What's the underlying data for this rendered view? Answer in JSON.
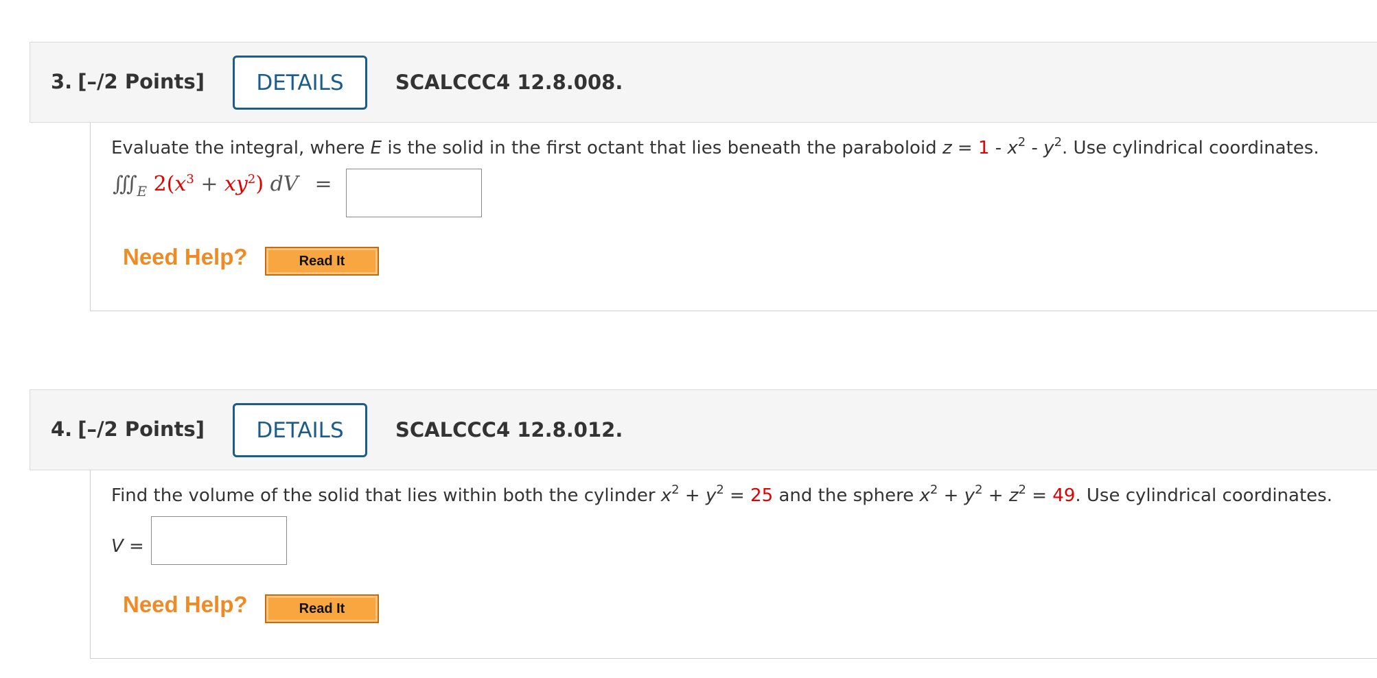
{
  "questions": [
    {
      "number": "3.",
      "points": "[–/2 Points]",
      "details_label": "DETAILS",
      "code": "SCALCCC4 12.8.008.",
      "prompt": {
        "p1": "Evaluate the integral, where ",
        "var_e": "E",
        "p2": " is the solid in the first octant that lies beneath the paraboloid ",
        "var_z": "z",
        "p3": " = ",
        "value": "1",
        "p4": " - ",
        "var_x": "x",
        "exp1": "2",
        "p5": " - ",
        "var_y": "y",
        "exp2": "2",
        "p6": ". Use cylindrical coordinates."
      },
      "integral": {
        "symbol": "∭",
        "region": "E",
        "coef": "2(",
        "x": "x",
        "x_exp": "3",
        "plus": " + ",
        "xy": "xy",
        "y_exp": "2",
        "close": ")",
        "dv": "dV",
        "equals": "="
      },
      "answer_value": "",
      "help_label": "Need Help?",
      "read_label": "Read It"
    },
    {
      "number": "4.",
      "points": "[–/2 Points]",
      "details_label": "DETAILS",
      "code": "SCALCCC4 12.8.012.",
      "prompt": {
        "p1": "Find the volume of the solid that lies within both the cylinder ",
        "x1": "x",
        "e1": "2",
        "plus1": " + ",
        "y1": "y",
        "e2": "2",
        "eq1": " = ",
        "val1": "25",
        "p2": " and the sphere ",
        "x2": "x",
        "e3": "2",
        "plus2": " + ",
        "y2": "y",
        "e4": "2",
        "plus3": " + ",
        "z2": "z",
        "e5": "2",
        "eq2": " = ",
        "val2": "49",
        "p3": ". Use cylindrical coordinates."
      },
      "answer_var": "V",
      "answer_eq": " =",
      "answer_value": "",
      "help_label": "Need Help?",
      "read_label": "Read It"
    }
  ],
  "colors": {
    "details_border": "#1c5c88",
    "help_text": "#f08a24",
    "read_button": "#f7a640",
    "highlight_value": "#e00000",
    "header_background": "#f5f5f5"
  }
}
